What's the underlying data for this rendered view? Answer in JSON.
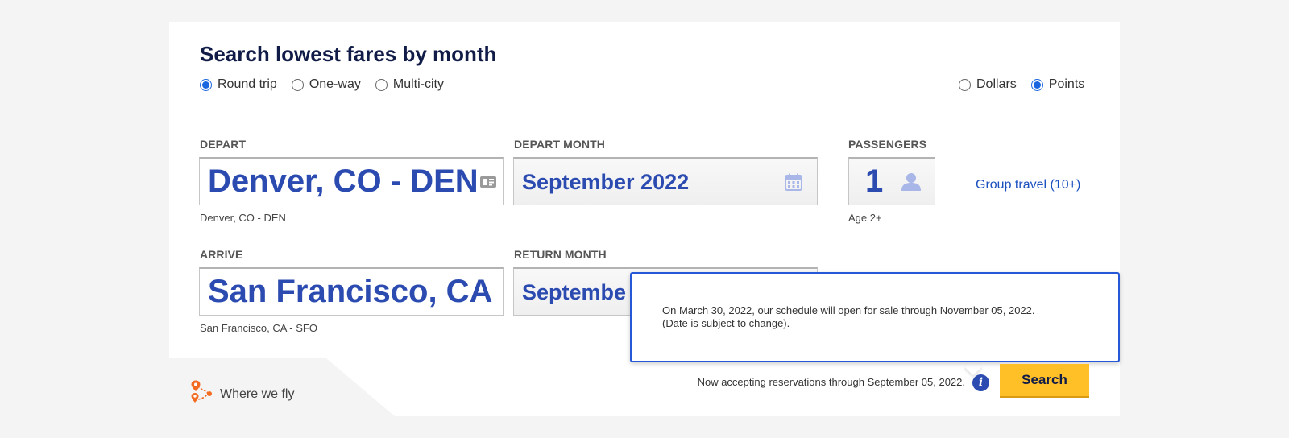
{
  "title": "Search lowest fares by month",
  "trip_types": [
    {
      "label": "Round trip",
      "checked": true
    },
    {
      "label": "One-way",
      "checked": false
    },
    {
      "label": "Multi-city",
      "checked": false
    }
  ],
  "currency": [
    {
      "label": "Dollars",
      "checked": false
    },
    {
      "label": "Points",
      "checked": true
    }
  ],
  "depart": {
    "label": "DEPART",
    "value": "Denver, CO - DEN",
    "sub": "Denver, CO - DEN"
  },
  "depart_month": {
    "label": "DEPART MONTH",
    "value": "September 2022"
  },
  "passengers": {
    "label": "PASSENGERS",
    "value": "1",
    "sub": "Age 2+"
  },
  "group_travel": "Group travel (10+)",
  "arrive": {
    "label": "ARRIVE",
    "value": "San Francisco, CA",
    "sub": "San Francisco, CA - SFO"
  },
  "return_month": {
    "label": "RETURN MONTH",
    "value": "Septembe"
  },
  "tooltip": {
    "line1": "On March 30, 2022, our schedule will open for sale through November 05, 2022.",
    "line2": "(Date is subject to change)."
  },
  "notice": "Now accepting reservations through September 05, 2022.",
  "search_button": "Search",
  "where_we_fly": "Where we fly",
  "colors": {
    "accent": "#2b4bb1",
    "button": "#ffbf27",
    "title": "#111b47",
    "icon_orange": "#f26b21"
  }
}
